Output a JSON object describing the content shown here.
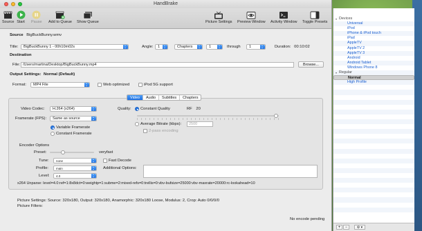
{
  "window": {
    "title": "HandBrake"
  },
  "toolbar": {
    "source": "Source",
    "start": "Start",
    "pause": "Pause",
    "add_to_queue": "Add to Queue",
    "show_queue": "Show Queue",
    "picture_settings": "Picture Settings",
    "preview_window": "Preview Window",
    "activity_window": "Activity Window",
    "toggle_presets": "Toggle Presets"
  },
  "source": {
    "label": "Source",
    "file": "BigBuckBunny.wmv",
    "title_label": "Title:",
    "title_value": "BigBuckBunny 1 - 00h10m02s",
    "angle_label": "Angle:",
    "angle_value": "1",
    "range_type": "Chapters",
    "range_from": "1",
    "through_label": "through",
    "range_to": "1",
    "duration_label": "Duration:",
    "duration_value": "00:10:02"
  },
  "destination": {
    "label": "Destination",
    "file_label": "File:",
    "file_path": "/Users/martina/Desktop/BigBuckBunny.mp4",
    "browse": "Browse..."
  },
  "output": {
    "settings_label": "Output Settings:",
    "preset_name": "Normal (Default)",
    "format_label": "Format:",
    "format_value": "MP4 File",
    "web_optimized": "Web optimized",
    "ipod_support": "iPod 5G support"
  },
  "tabs": [
    {
      "label": "Video"
    },
    {
      "label": "Audio"
    },
    {
      "label": "Subtitles"
    },
    {
      "label": "Chapters"
    }
  ],
  "video": {
    "codec_label": "Video Codec:",
    "codec_value": "H.264 (x264)",
    "framerate_label": "Framerate (FPS):",
    "framerate_value": "Same as source",
    "variable_framerate": "Variable Framerate",
    "constant_framerate": "Constant Framerate",
    "quality_label": "Quality:",
    "constant_quality": "Constant Quality",
    "rf_label": "RF",
    "rf_value": "20",
    "average_bitrate": "Average Bitrate (kbps):",
    "bitrate_value": "2500",
    "two_pass": "2-pass encoding"
  },
  "encoder": {
    "title": "Encoder Options",
    "preset_label": "Preset:",
    "preset_value": "veryfast",
    "tune_label": "Tune:",
    "tune_value": "none",
    "fast_decode": "Fast Decode",
    "profile_label": "Profile:",
    "profile_value": "main",
    "level_label": "Level:",
    "level_value": "4.0",
    "additional_label": "Additional Options:",
    "unparse": "x264 Unparse: level=4.0:ref=1:8x8dct=0:weightp=1:subme=2:mixed-refs=0:trellis=0:vbv-bufsize=25000:vbv-maxrate=20000:rc-lookahead=10"
  },
  "picture": {
    "settings": "Picture Settings: Source: 320x180, Output: 320x180, Anamorphic: 320x180 Loose, Modulus: 2, Crop: Auto 0/0/0/0",
    "filters": "Picture Filters:"
  },
  "status": "No encode pending",
  "presets": {
    "groups": [
      {
        "name": "Devices",
        "items": [
          "Universal",
          "iPod",
          "iPhone & iPod touch",
          "iPad",
          "AppleTV",
          "AppleTV 2",
          "AppleTV 3",
          "Android",
          "Android Tablet",
          "Windows Phone 8"
        ]
      },
      {
        "name": "Regular",
        "items": [
          "Normal",
          "High Profile"
        ]
      }
    ],
    "selected": "Normal",
    "add": "+",
    "remove": "−",
    "gear": "⚙ ▾"
  },
  "colors": {
    "accent": "#1f6fe0",
    "preset_link": "#1a5fd0"
  }
}
